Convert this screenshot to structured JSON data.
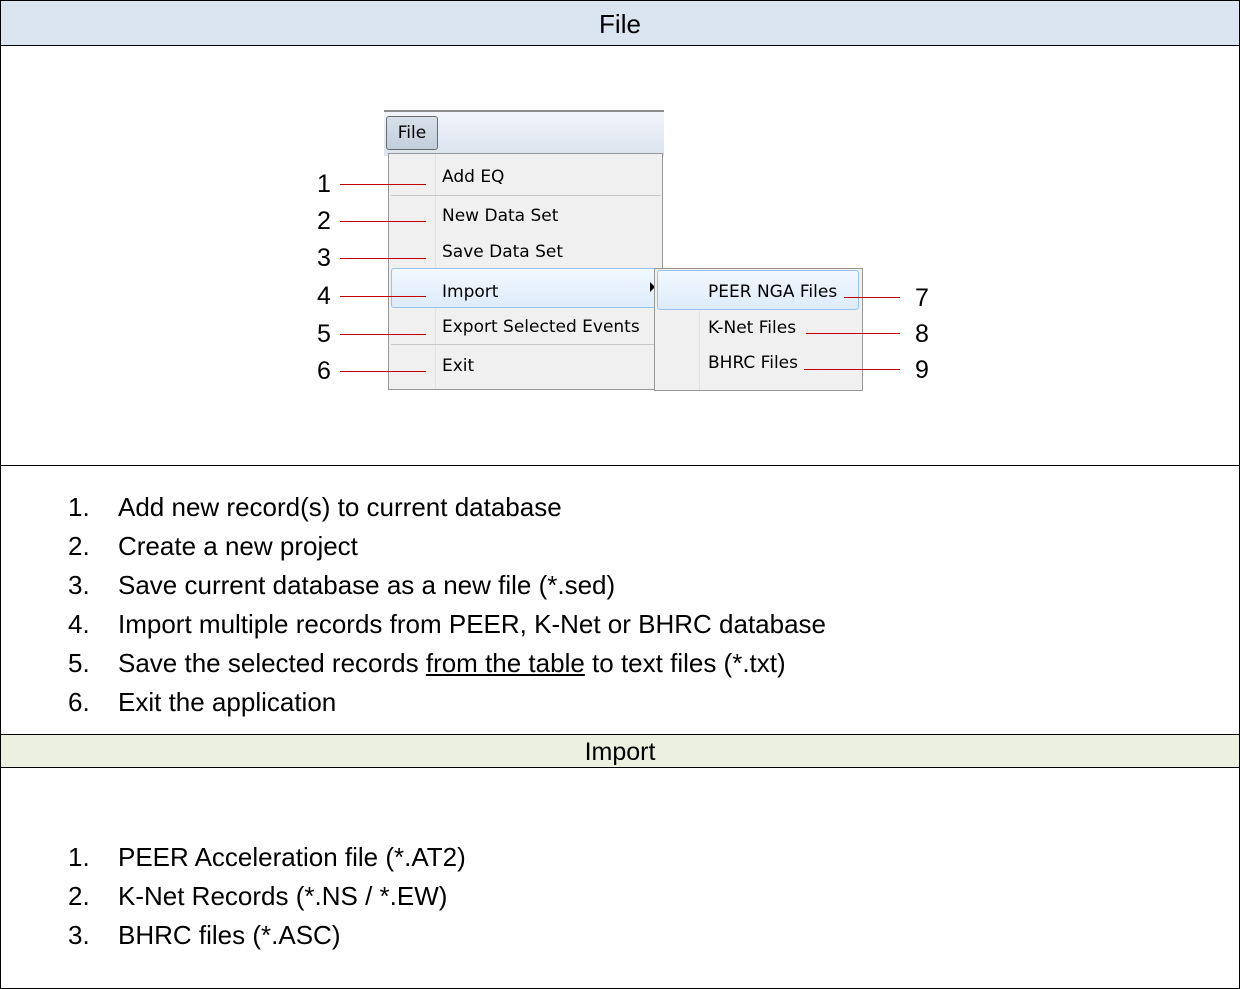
{
  "file_section": {
    "title": "File",
    "menu": {
      "file_button": "File",
      "items": [
        "Add EQ",
        "New Data Set",
        "Save Data Set",
        "Import",
        "Export Selected Events",
        "Exit"
      ],
      "submenu": [
        "PEER NGA Files",
        "K-Net Files",
        "BHRC Files"
      ],
      "callouts": [
        "1",
        "2",
        "3",
        "4",
        "5",
        "6",
        "7",
        "8",
        "9"
      ],
      "callout_color": "#c00000",
      "highlight_color": "#99c3ee"
    },
    "descriptions": [
      {
        "num": "1.",
        "text": "Add new record(s) to current database"
      },
      {
        "num": "2.",
        "text": "Create a new project"
      },
      {
        "num": "3.",
        "text": "Save current database as a new file (*.sed)"
      },
      {
        "num": "4.",
        "text": "Import multiple records from PEER, K-Net or BHRC database"
      },
      {
        "num": "5.",
        "text_before": "Save the selected records ",
        "text_underlined": "from the table",
        "text_after": " to text files (*.txt)"
      },
      {
        "num": "6.",
        "text": "Exit the application"
      }
    ]
  },
  "import_section": {
    "title": "Import",
    "items": [
      {
        "num": "1.",
        "text": "PEER Acceleration file (*.AT2)"
      },
      {
        "num": "2.",
        "text": "K-Net Records (*.NS / *.EW)"
      },
      {
        "num": "3.",
        "text": "BHRC files (*.ASC)"
      }
    ]
  },
  "colors": {
    "file_header_bg": "#dbe5f1",
    "import_header_bg": "#ebf1de"
  }
}
